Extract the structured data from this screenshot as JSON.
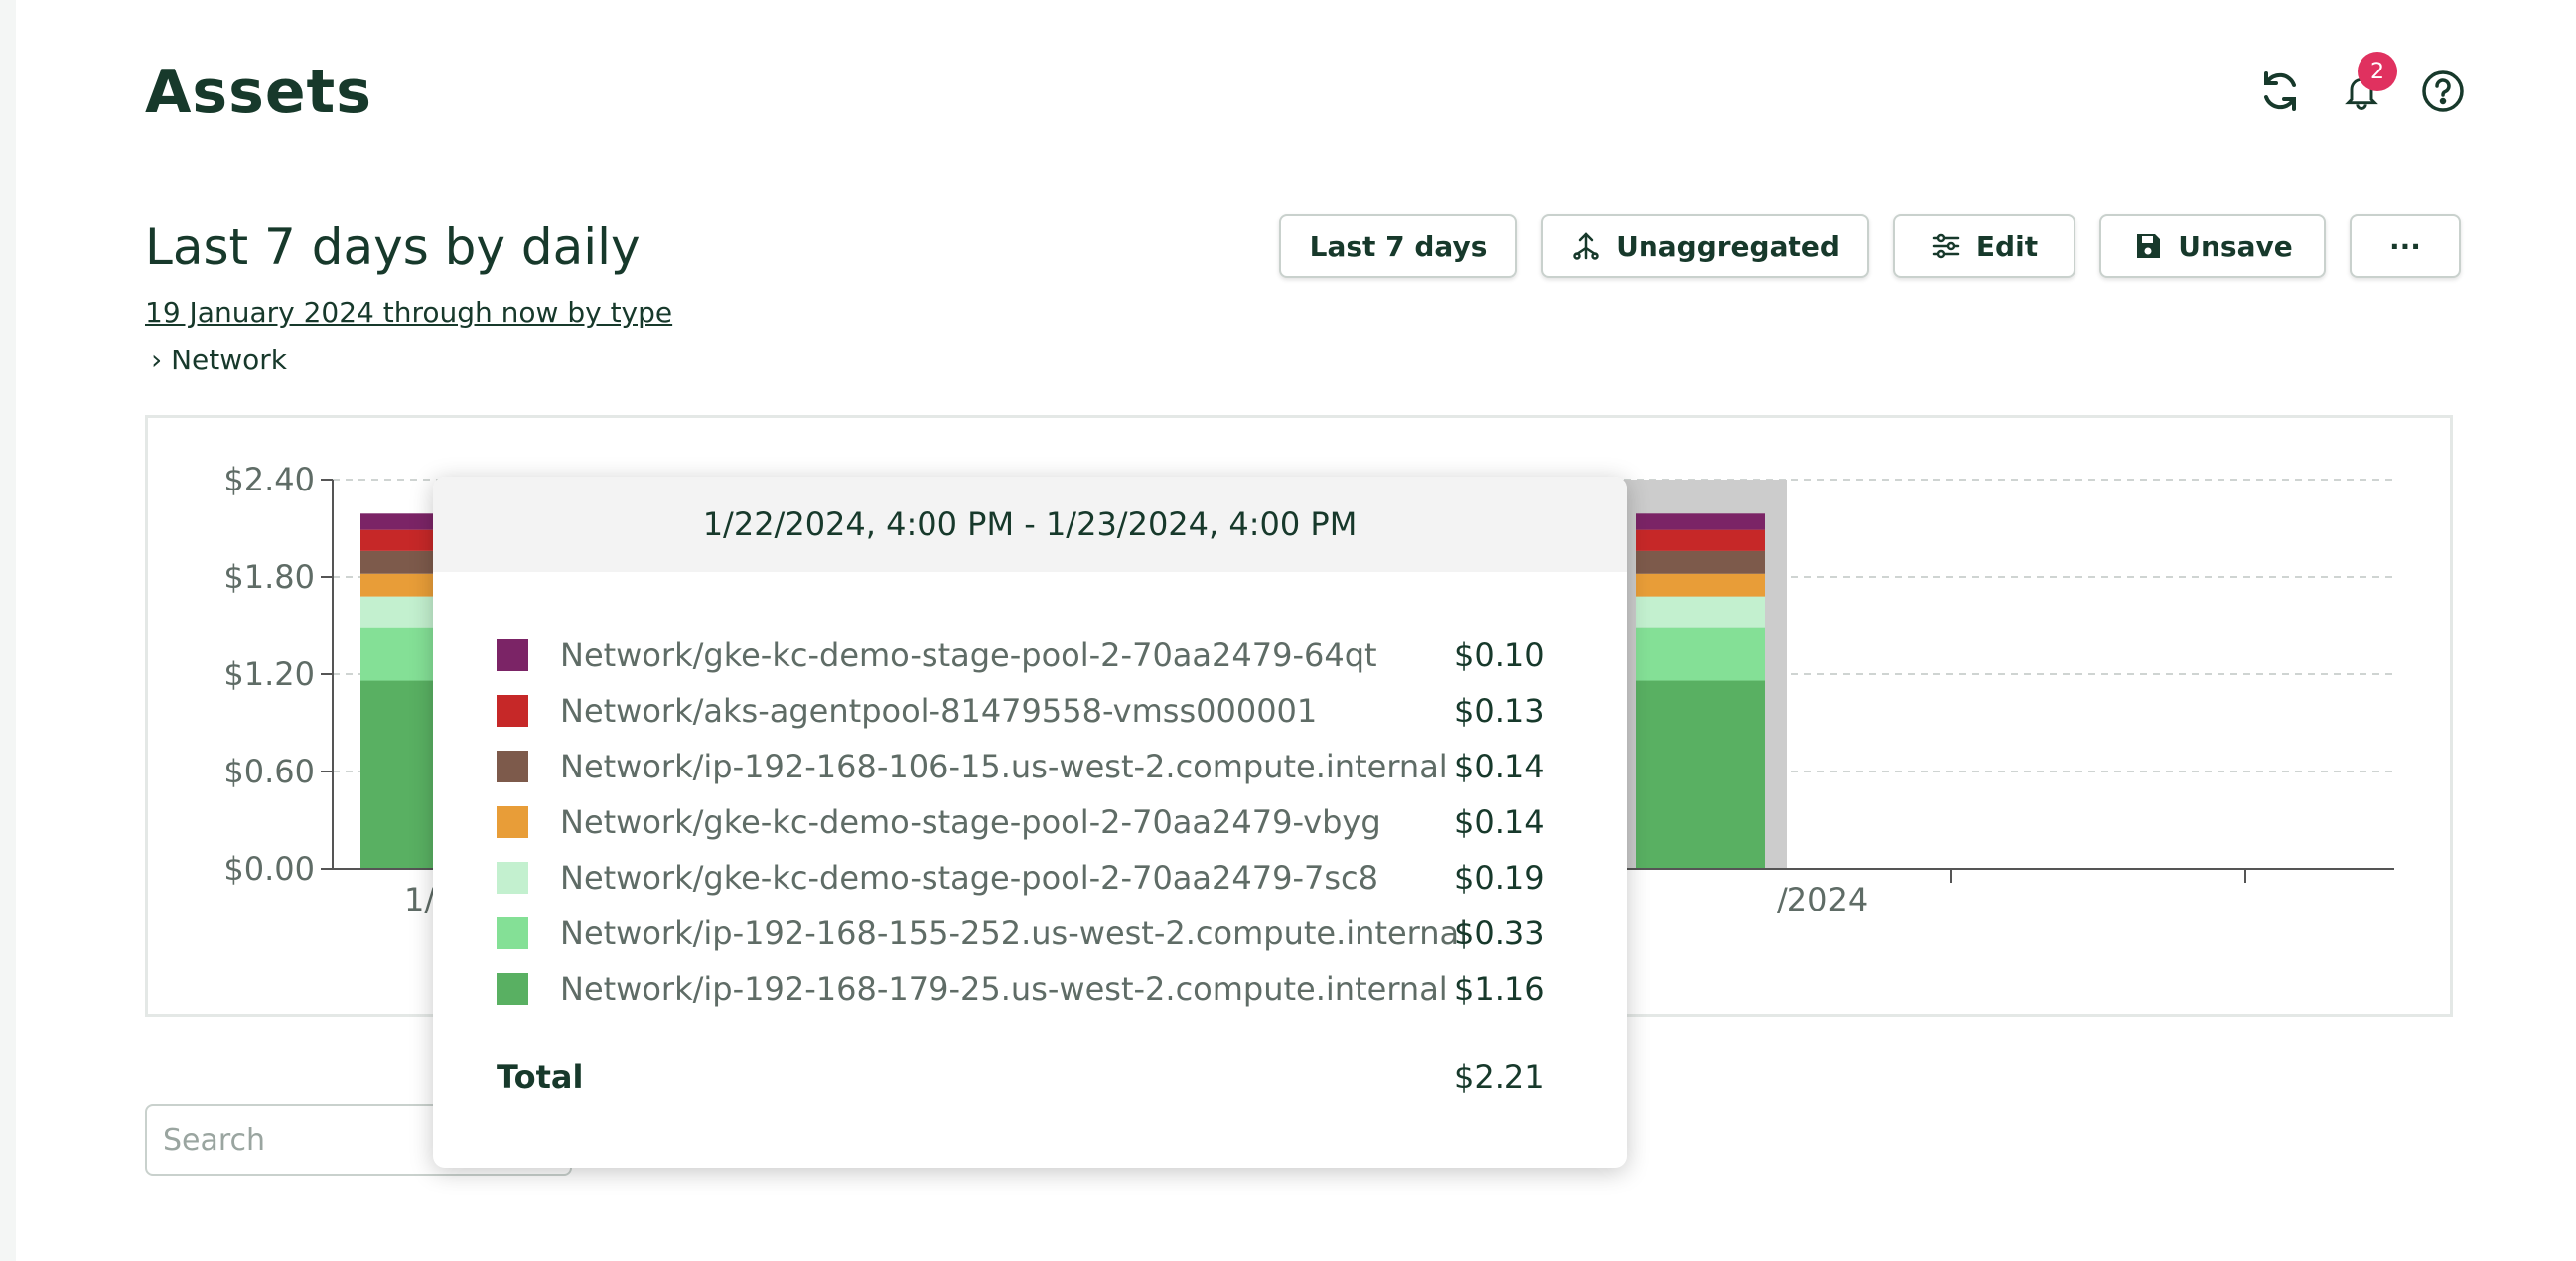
{
  "header": {
    "title": "Assets",
    "notification_count": "2"
  },
  "report": {
    "title": "Last 7 days by daily",
    "subtitle": "19 January 2024 through now by type",
    "breadcrumb": "› Network"
  },
  "toolbar": {
    "range_label": "Last 7 days",
    "aggregate_label": "Unaggregated",
    "edit_label": "Edit",
    "unsave_label": "Unsave",
    "more_label": "···"
  },
  "search": {
    "placeholder": "Search"
  },
  "tooltip": {
    "range": "1/22/2024, 4:00 PM - 1/23/2024, 4:00 PM",
    "items": [
      {
        "label": "Network/gke-kc-demo-stage-pool-2-70aa2479-64qt",
        "value": "$0.10",
        "color": "#7b2466"
      },
      {
        "label": "Network/aks-agentpool-81479558-vmss000001",
        "value": "$0.13",
        "color": "#c62828"
      },
      {
        "label": "Network/ip-192-168-106-15.us-west-2.compute.internal",
        "value": "$0.14",
        "color": "#7d5a4b"
      },
      {
        "label": "Network/gke-kc-demo-stage-pool-2-70aa2479-vbyg",
        "value": "$0.14",
        "color": "#e89d38"
      },
      {
        "label": "Network/gke-kc-demo-stage-pool-2-70aa2479-7sc8",
        "value": "$0.19",
        "color": "#c3f0cf"
      },
      {
        "label": "Network/ip-192-168-155-252.us-west-2.compute.internal",
        "value": "$0.33",
        "color": "#84e096"
      },
      {
        "label": "Network/ip-192-168-179-25.us-west-2.compute.internal",
        "value": "$1.16",
        "color": "#59b062"
      }
    ],
    "total_label": "Total",
    "total_value": "$2.21"
  },
  "chart_data": {
    "type": "bar",
    "y_ticks": [
      "$0.00",
      "$0.60",
      "$1.20",
      "$1.80",
      "$2.40"
    ],
    "ylim": [
      0,
      2.4
    ],
    "x_labels": [
      "1/",
      "/2024"
    ],
    "grid": true,
    "stack_values": [
      1.16,
      0.33,
      0.19,
      0.14,
      0.14,
      0.13,
      0.1
    ],
    "stack_colors": [
      "#59b062",
      "#84e096",
      "#c3f0cf",
      "#e89d38",
      "#7d5a4b",
      "#c62828",
      "#7b2466"
    ]
  }
}
